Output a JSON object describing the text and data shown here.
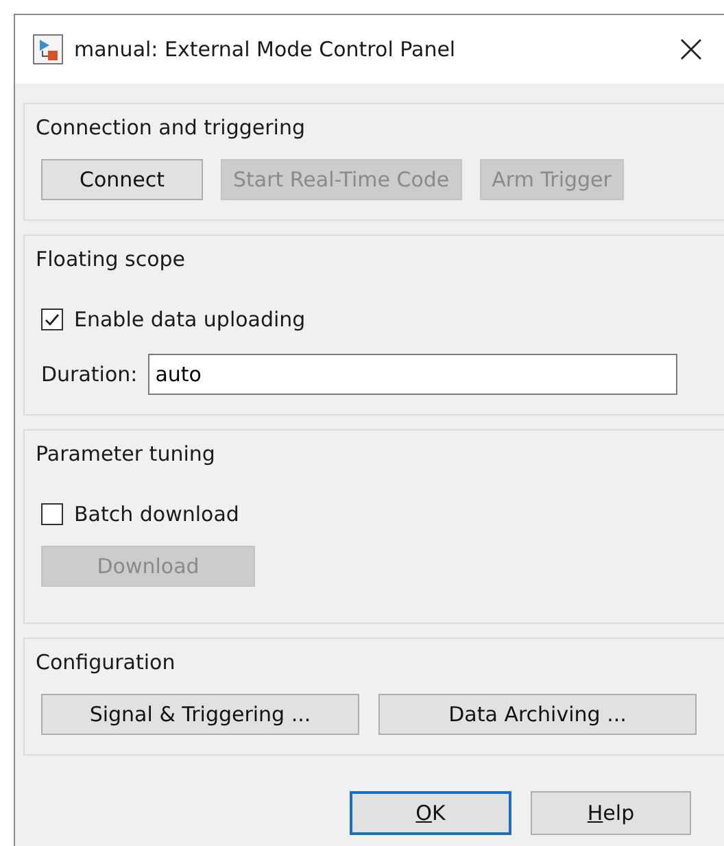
{
  "window": {
    "title": "manual: External Mode Control Panel"
  },
  "connection": {
    "title": "Connection and triggering",
    "buttons": [
      {
        "label": "Connect",
        "disabled": false
      },
      {
        "label": "Start Real-Time Code",
        "disabled": true
      },
      {
        "label": "Arm Trigger",
        "disabled": true
      }
    ]
  },
  "floating_scope": {
    "title": "Floating scope",
    "checkbox": {
      "label": "Enable data uploading",
      "checked": true
    },
    "duration": {
      "label": "Duration:",
      "value": "auto"
    }
  },
  "parameter_tuning": {
    "title": "Parameter tuning",
    "checkbox": {
      "label": "Batch download",
      "checked": false
    },
    "button": {
      "label": "Download",
      "disabled": true
    }
  },
  "configuration": {
    "title": "Configuration",
    "buttons": [
      {
        "label": "Signal & Triggering ..."
      },
      {
        "label": "Data Archiving ..."
      }
    ]
  },
  "footer_buttons": [
    {
      "access_key": "O",
      "rest": "K",
      "default": true
    },
    {
      "access_key": "H",
      "rest": "elp",
      "default": false
    }
  ]
}
